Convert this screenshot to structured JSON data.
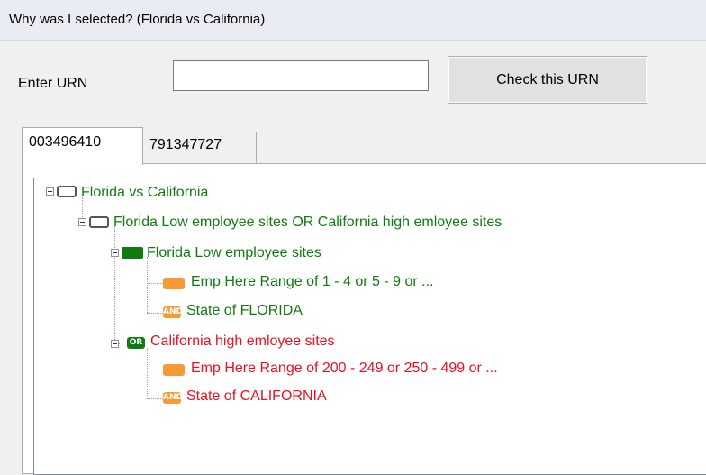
{
  "window": {
    "title": "Why was I selected? (Florida vs California)"
  },
  "form": {
    "urn_label": "Enter URN",
    "urn_value": "",
    "check_label": "Check this URN"
  },
  "tabs": [
    {
      "label": "003496410",
      "active": true
    },
    {
      "label": "791347727",
      "active": false
    }
  ],
  "tree": {
    "root": {
      "label": "Florida vs California",
      "icon": "condition-group-icon"
    },
    "or_group": {
      "label": "Florida Low employee sites OR California high emloyee sites",
      "icon": "condition-group-icon"
    },
    "florida": {
      "label": "Florida Low employee sites",
      "icon": "green-condition-icon",
      "children": [
        {
          "label": "Emp Here Range of   1 - 4 or   5 - 9 or ...",
          "icon": "orange-condition-icon"
        },
        {
          "label": "State of FLORIDA",
          "icon": "and-operator-icon",
          "badge": "AND"
        }
      ]
    },
    "california": {
      "label": "California high emloyee sites",
      "icon": "or-operator-icon",
      "badge": "OR",
      "children": [
        {
          "label": "Emp Here Range of 200 - 249 or 250 - 499 or ...",
          "icon": "orange-condition-icon"
        },
        {
          "label": "State of CALIFORNIA",
          "icon": "and-operator-icon",
          "badge": "AND"
        }
      ]
    }
  },
  "colors": {
    "matched": "#107c10",
    "unmatched": "#e81123",
    "condition": "#f59a35"
  }
}
